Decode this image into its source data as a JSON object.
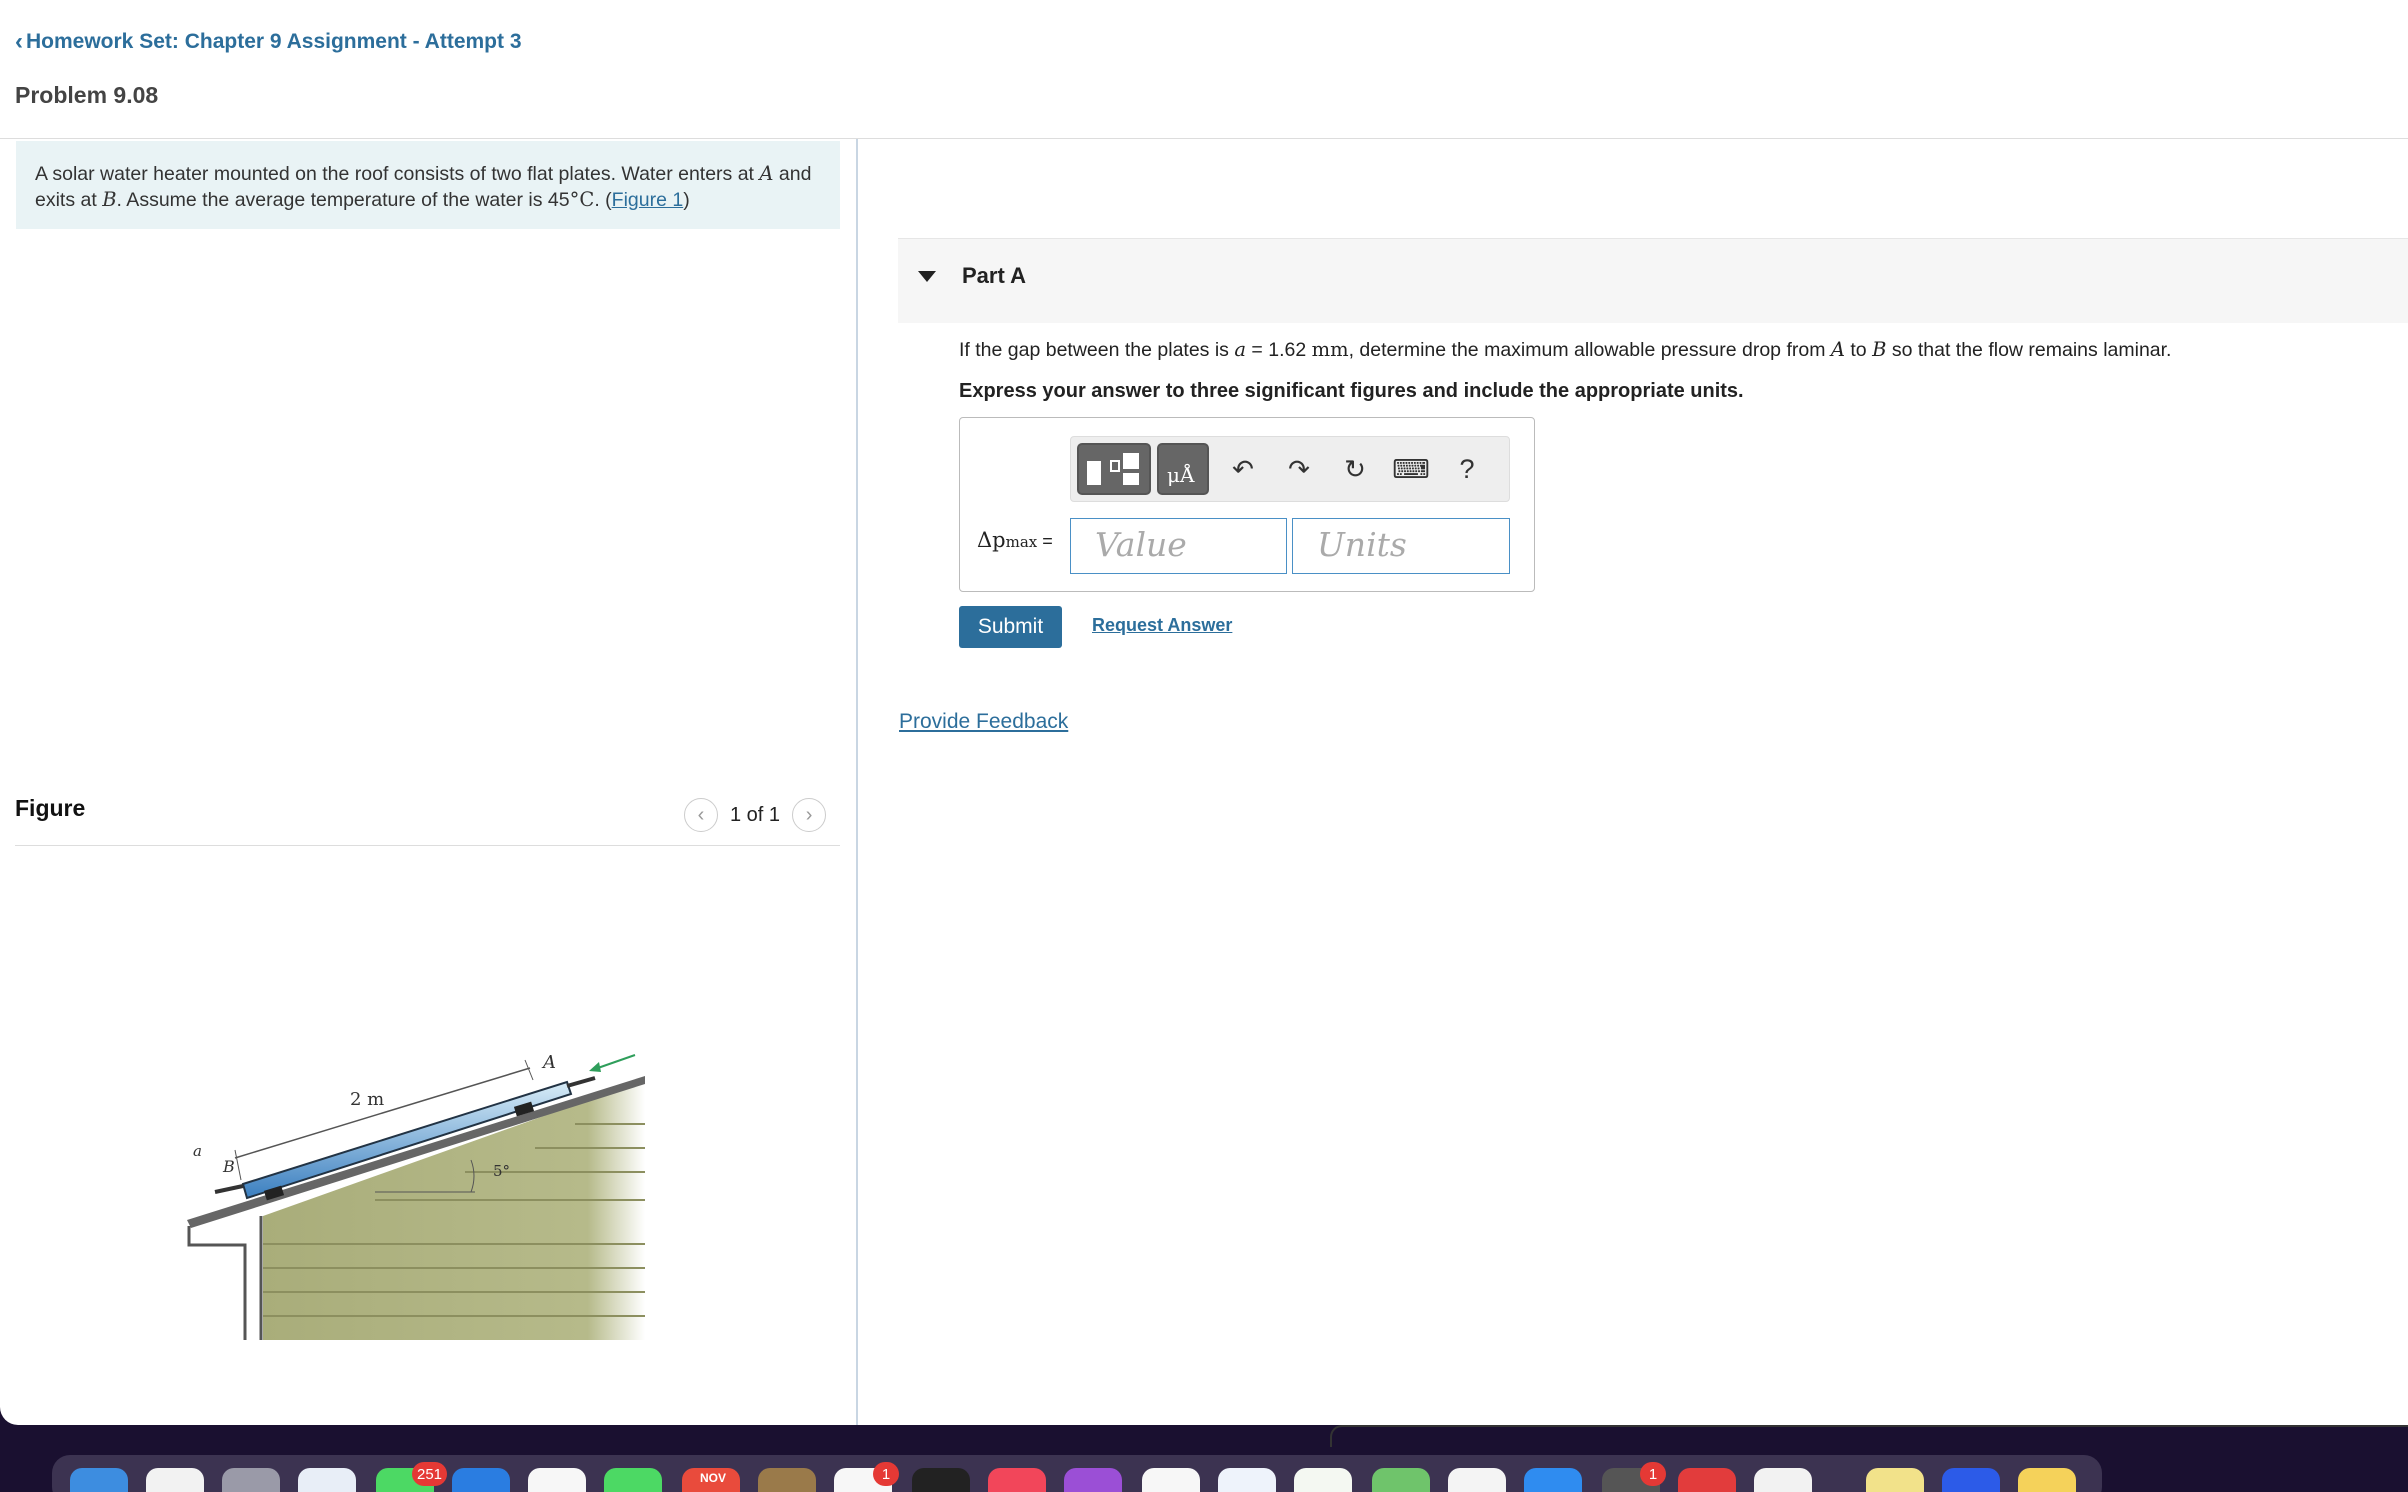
{
  "header": {
    "back_link": "Homework Set: Chapter 9 Assignment - Attempt 3",
    "problem_title": "Problem 9.08"
  },
  "problem": {
    "text_1": "A solar water heater mounted on the roof consists of two flat plates. Water enters at ",
    "var_A": "A",
    "text_2": " and exits at ",
    "var_B": "B",
    "text_3": ". Assume the average temperature of the water is 45",
    "deg": "°",
    "unit_C": "C",
    "text_4": ". (",
    "figure_link": "Figure 1",
    "text_5": ")"
  },
  "figure": {
    "title": "Figure",
    "counter": "1 of 1",
    "prev_icon": "chevron-left",
    "next_icon": "chevron-right",
    "labels": {
      "length": "2 m",
      "angle": "5°",
      "point_a": "A",
      "point_b": "B",
      "gap": "a"
    }
  },
  "part": {
    "label": "Part A",
    "question_1": "If the gap between the plates is ",
    "var_a": "a",
    "question_2": " = 1.62 ",
    "unit_mm": "mm",
    "question_3": ", determine the maximum allowable pressure drop from ",
    "var_A": "A",
    "question_4": " to ",
    "var_B": "B",
    "question_5": " so that the flow remains laminar.",
    "instruction": "Express your answer to three significant figures and include the appropriate units."
  },
  "answer": {
    "symbol": "Δp",
    "subscript": "max",
    "equals": " =",
    "value_placeholder": "Value",
    "units_placeholder": "Units",
    "toolbar": {
      "templates_icon": "templates-icon",
      "units_icon": "units-mu-angstrom-icon",
      "units_glyph": "μÅ",
      "undo": "↶",
      "redo": "↷",
      "reset": "↻",
      "keyboard": "⌨",
      "help": "?"
    }
  },
  "actions": {
    "submit": "Submit",
    "request_answer": "Request Answer",
    "feedback": "Provide Feedback"
  },
  "dock": {
    "calendar_month": "NOV",
    "badges": {
      "messages": "251",
      "reminders": "1",
      "system_settings": "1"
    }
  },
  "colors": {
    "link": "#2c6e9b",
    "problem_bg": "#e9f3f5",
    "input_border": "#4a90c6",
    "badge": "#e53935"
  }
}
